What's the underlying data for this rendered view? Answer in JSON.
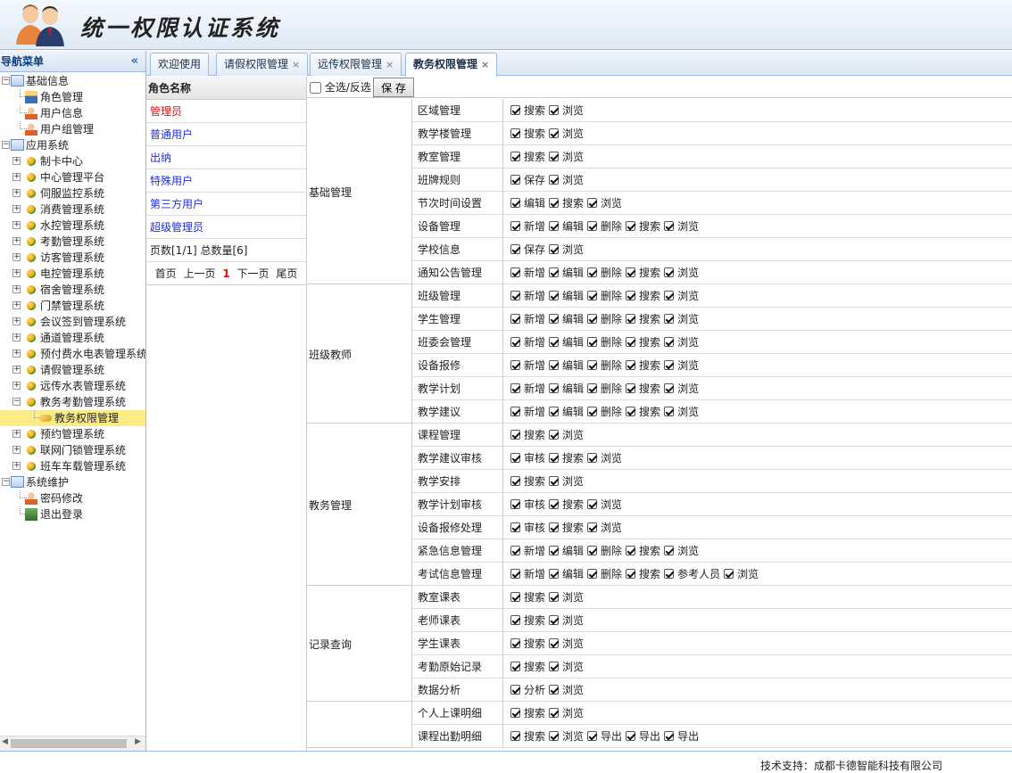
{
  "header": {
    "title": "统一权限认证系统"
  },
  "nav": {
    "title": "导航菜单",
    "tree": [
      {
        "level": 0,
        "label": "基础信息",
        "expanded": true,
        "icon": "folder-icon"
      },
      {
        "level": 1,
        "label": "角色管理",
        "icon": "users-icon"
      },
      {
        "level": 1,
        "label": "用户信息",
        "icon": "user-icon"
      },
      {
        "level": 1,
        "label": "用户组管理",
        "icon": "user-group-icon"
      },
      {
        "level": 0,
        "label": "应用系统",
        "expanded": true,
        "icon": "home-icon"
      },
      {
        "level": 1,
        "label": "制卡中心",
        "toggle": true
      },
      {
        "level": 1,
        "label": "中心管理平台",
        "toggle": true
      },
      {
        "level": 1,
        "label": "伺服监控系统",
        "toggle": true
      },
      {
        "level": 1,
        "label": "消费管理系统",
        "toggle": true
      },
      {
        "level": 1,
        "label": "水控管理系统",
        "toggle": true
      },
      {
        "level": 1,
        "label": "考勤管理系统",
        "toggle": true
      },
      {
        "level": 1,
        "label": "访客管理系统",
        "toggle": true
      },
      {
        "level": 1,
        "label": "电控管理系统",
        "toggle": true
      },
      {
        "level": 1,
        "label": "宿舍管理系统",
        "toggle": true
      },
      {
        "level": 1,
        "label": "门禁管理系统",
        "toggle": true
      },
      {
        "level": 1,
        "label": "会议签到管理系统",
        "toggle": true
      },
      {
        "level": 1,
        "label": "通道管理系统",
        "toggle": true
      },
      {
        "level": 1,
        "label": "预付费水电表管理系统",
        "toggle": true
      },
      {
        "level": 1,
        "label": "请假管理系统",
        "toggle": true
      },
      {
        "level": 1,
        "label": "远传水表管理系统",
        "toggle": true
      },
      {
        "level": 1,
        "label": "教务考勤管理系统",
        "toggle": true,
        "expanded": true
      },
      {
        "level": 2,
        "label": "教务权限管理",
        "selected": true,
        "icon": "key-icon"
      },
      {
        "level": 1,
        "label": "预约管理系统",
        "toggle": true
      },
      {
        "level": 1,
        "label": "联网门锁管理系统",
        "toggle": true
      },
      {
        "level": 1,
        "label": "班车车载管理系统",
        "toggle": true
      },
      {
        "level": 0,
        "label": "系统维护",
        "expanded": true,
        "icon": "monitor-icon"
      },
      {
        "level": 1,
        "label": "密码修改",
        "icon": "user-key-icon"
      },
      {
        "level": 1,
        "label": "退出登录",
        "icon": "logout-icon"
      }
    ]
  },
  "tabs": [
    {
      "label": "欢迎使用",
      "closable": false
    },
    {
      "label": "请假权限管理",
      "closable": true
    },
    {
      "label": "远传权限管理",
      "closable": true
    },
    {
      "label": "教务权限管理",
      "closable": true,
      "active": true
    }
  ],
  "roles": {
    "header": "角色名称",
    "items": [
      "管理员",
      "普通用户",
      "出纳",
      "特殊用户",
      "第三方用户",
      "超级管理员"
    ],
    "page_info": "页数[1/1] 总数量[6]",
    "pager": {
      "first": "首页",
      "prev": "上一页",
      "current": "1",
      "next": "下一页",
      "last": "尾页"
    }
  },
  "toolbar": {
    "select_all": "全选/反选",
    "save": "保 存"
  },
  "groups": [
    {
      "name": "基础管理",
      "modules": [
        {
          "name": "区域管理",
          "ops": [
            "搜索",
            "浏览"
          ]
        },
        {
          "name": "教学楼管理",
          "ops": [
            "搜索",
            "浏览"
          ]
        },
        {
          "name": "教室管理",
          "ops": [
            "搜索",
            "浏览"
          ]
        },
        {
          "name": "班牌规则",
          "ops": [
            "保存",
            "浏览"
          ]
        },
        {
          "name": "节次时间设置",
          "ops": [
            "编辑",
            "搜索",
            "浏览"
          ]
        },
        {
          "name": "设备管理",
          "ops": [
            "新增",
            "编辑",
            "删除",
            "搜索",
            "浏览"
          ]
        },
        {
          "name": "学校信息",
          "ops": [
            "保存",
            "浏览"
          ]
        },
        {
          "name": "通知公告管理",
          "ops": [
            "新增",
            "编辑",
            "删除",
            "搜索",
            "浏览"
          ]
        }
      ]
    },
    {
      "name": "班级教师",
      "modules": [
        {
          "name": "班级管理",
          "ops": [
            "新增",
            "编辑",
            "删除",
            "搜索",
            "浏览"
          ]
        },
        {
          "name": "学生管理",
          "ops": [
            "新增",
            "编辑",
            "删除",
            "搜索",
            "浏览"
          ]
        },
        {
          "name": "班委会管理",
          "ops": [
            "新增",
            "编辑",
            "删除",
            "搜索",
            "浏览"
          ]
        },
        {
          "name": "设备报修",
          "ops": [
            "新增",
            "编辑",
            "删除",
            "搜索",
            "浏览"
          ]
        },
        {
          "name": "教学计划",
          "ops": [
            "新增",
            "编辑",
            "删除",
            "搜索",
            "浏览"
          ]
        },
        {
          "name": "教学建议",
          "ops": [
            "新增",
            "编辑",
            "删除",
            "搜索",
            "浏览"
          ]
        }
      ]
    },
    {
      "name": "教务管理",
      "modules": [
        {
          "name": "课程管理",
          "ops": [
            "搜索",
            "浏览"
          ]
        },
        {
          "name": "教学建议审核",
          "ops": [
            "审核",
            "搜索",
            "浏览"
          ]
        },
        {
          "name": "教学安排",
          "ops": [
            "搜索",
            "浏览"
          ]
        },
        {
          "name": "教学计划审核",
          "ops": [
            "审核",
            "搜索",
            "浏览"
          ]
        },
        {
          "name": "设备报修处理",
          "ops": [
            "审核",
            "搜索",
            "浏览"
          ]
        },
        {
          "name": "紧急信息管理",
          "ops": [
            "新增",
            "编辑",
            "删除",
            "搜索",
            "浏览"
          ]
        },
        {
          "name": "考试信息管理",
          "ops": [
            "新增",
            "编辑",
            "删除",
            "搜索",
            "参考人员",
            "浏览"
          ]
        }
      ]
    },
    {
      "name": "记录查询",
      "modules": [
        {
          "name": "教室课表",
          "ops": [
            "搜索",
            "浏览"
          ]
        },
        {
          "name": "老师课表",
          "ops": [
            "搜索",
            "浏览"
          ]
        },
        {
          "name": "学生课表",
          "ops": [
            "搜索",
            "浏览"
          ]
        },
        {
          "name": "考勤原始记录",
          "ops": [
            "搜索",
            "浏览"
          ]
        },
        {
          "name": "数据分析",
          "ops": [
            "分析",
            "浏览"
          ]
        }
      ]
    },
    {
      "name": "",
      "modules": [
        {
          "name": "个人上课明细",
          "ops": [
            "搜索",
            "浏览"
          ]
        },
        {
          "name": "课程出勤明细",
          "ops": [
            "搜索",
            "浏览",
            "导出",
            "导出",
            "导出"
          ]
        }
      ]
    }
  ],
  "footer": {
    "text": "技术支持：成都卡德智能科技有限公司"
  }
}
